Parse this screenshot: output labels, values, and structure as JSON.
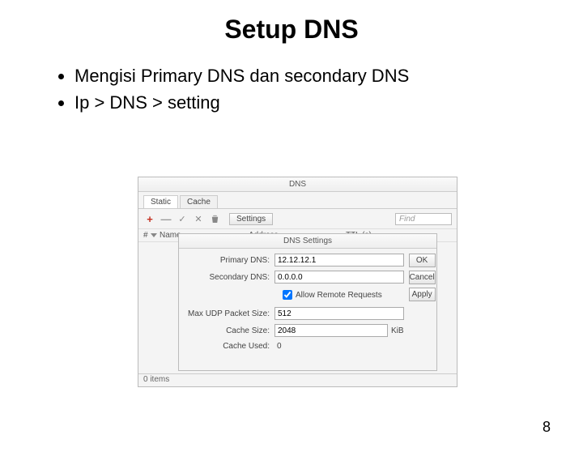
{
  "slide": {
    "title": "Setup DNS",
    "bullets": [
      "Mengisi Primary DNS dan secondary DNS",
      "Ip > DNS > setting"
    ],
    "page_number": "8"
  },
  "dns_window": {
    "title": "DNS",
    "tabs": {
      "static": "Static",
      "cache": "Cache"
    },
    "toolbar": {
      "plus": "+",
      "minus": "—",
      "check": "✓",
      "x": "✕",
      "settings_label": "Settings",
      "find_placeholder": "Find"
    },
    "columns": {
      "num": "#",
      "name": "Name",
      "address": "Address",
      "ttl": "TTL (s)"
    },
    "status": "0 items"
  },
  "settings_dialog": {
    "title": "DNS Settings",
    "primary_label": "Primary DNS:",
    "primary_value": "12.12.12.1",
    "secondary_label": "Secondary DNS:",
    "secondary_value": "0.0.0.0",
    "allow_remote_label": "Allow Remote Requests",
    "allow_remote_checked": true,
    "max_udp_label": "Max UDP Packet Size:",
    "max_udp_value": "512",
    "cache_size_label": "Cache Size:",
    "cache_size_value": "2048",
    "cache_size_unit": "KiB",
    "cache_used_label": "Cache Used:",
    "cache_used_value": "0",
    "buttons": {
      "ok": "OK",
      "cancel": "Cancel",
      "apply": "Apply"
    }
  }
}
